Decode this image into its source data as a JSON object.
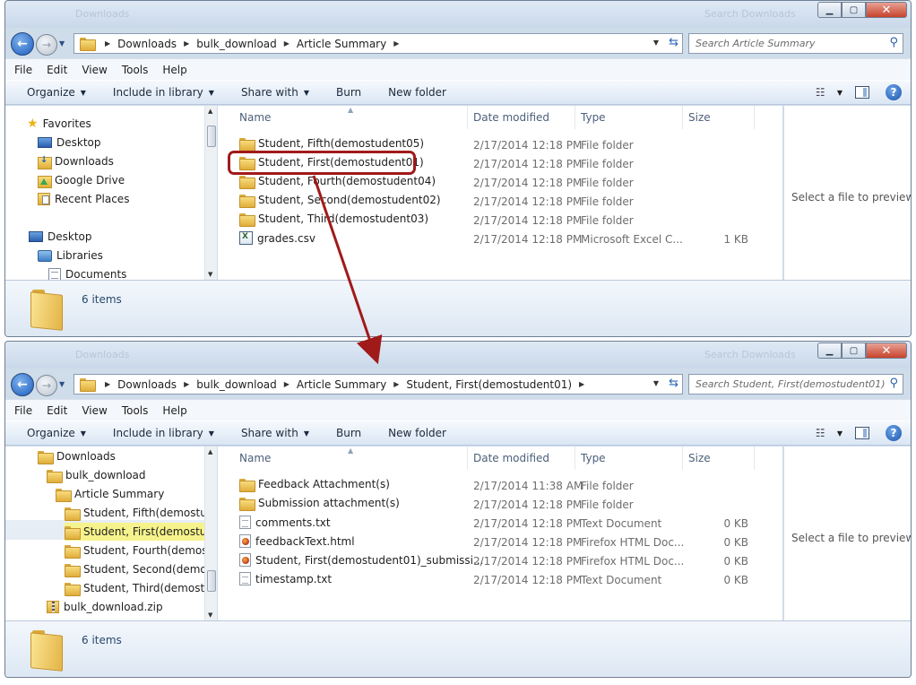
{
  "win1": {
    "title_blur": "Downloads",
    "title_blur_right": "Search Downloads",
    "breadcrumb": [
      "Downloads",
      "bulk_download",
      "Article Summary"
    ],
    "search_placeholder": "Search Article Summary",
    "menu": [
      "File",
      "Edit",
      "View",
      "Tools",
      "Help"
    ],
    "commands": [
      {
        "label": "Organize",
        "dropdown": true
      },
      {
        "label": "Include in library",
        "dropdown": true
      },
      {
        "label": "Share with",
        "dropdown": true
      },
      {
        "label": "Burn",
        "dropdown": false
      },
      {
        "label": "New folder",
        "dropdown": false
      }
    ],
    "nav": [
      {
        "label": "Favorites",
        "icon": "star-icon"
      },
      {
        "label": "Desktop",
        "icon": "desktop-icon"
      },
      {
        "label": "Downloads",
        "icon": "downloads-icon"
      },
      {
        "label": "Google Drive",
        "icon": "google-drive-icon"
      },
      {
        "label": "Recent Places",
        "icon": "recent-places-icon"
      },
      {
        "label": "Desktop",
        "icon": "desktop-icon"
      },
      {
        "label": "Libraries",
        "icon": "libraries-icon"
      },
      {
        "label": "Documents",
        "icon": "documents-icon"
      }
    ],
    "columns": [
      "Name",
      "Date modified",
      "Type",
      "Size"
    ],
    "files": [
      {
        "name": "Student, Fifth(demostudent05)",
        "date": "2/17/2014 12:18 PM",
        "type": "File folder",
        "size": "",
        "icon": "folder-icon"
      },
      {
        "name": "Student, First(demostudent01)",
        "date": "2/17/2014 12:18 PM",
        "type": "File folder",
        "size": "",
        "icon": "folder-icon"
      },
      {
        "name": "Student, Fourth(demostudent04)",
        "date": "2/17/2014 12:18 PM",
        "type": "File folder",
        "size": "",
        "icon": "folder-icon"
      },
      {
        "name": "Student, Second(demostudent02)",
        "date": "2/17/2014 12:18 PM",
        "type": "File folder",
        "size": "",
        "icon": "folder-icon"
      },
      {
        "name": "Student, Third(demostudent03)",
        "date": "2/17/2014 12:18 PM",
        "type": "File folder",
        "size": "",
        "icon": "folder-icon"
      },
      {
        "name": "grades.csv",
        "date": "2/17/2014 12:18 PM",
        "type": "Microsoft Excel C...",
        "size": "1 KB",
        "icon": "csv-file-icon"
      }
    ],
    "preview_text": "Select a file to preview.",
    "item_count": "6 items"
  },
  "win2": {
    "title_blur": "Downloads",
    "title_blur_right": "Search Downloads",
    "breadcrumb": [
      "Downloads",
      "bulk_download",
      "Article Summary",
      "Student, First(demostudent01)"
    ],
    "search_placeholder": "Search Student, First(demostudent01)",
    "menu": [
      "File",
      "Edit",
      "View",
      "Tools",
      "Help"
    ],
    "commands": [
      {
        "label": "Organize",
        "dropdown": true
      },
      {
        "label": "Include in library",
        "dropdown": true
      },
      {
        "label": "Share with",
        "dropdown": true
      },
      {
        "label": "Burn",
        "dropdown": false
      },
      {
        "label": "New folder",
        "dropdown": false
      }
    ],
    "nav": [
      {
        "label": "Downloads",
        "icon": "folder-icon"
      },
      {
        "label": "bulk_download",
        "icon": "folder-icon"
      },
      {
        "label": "Article Summary",
        "icon": "folder-icon"
      },
      {
        "label": "Student, Fifth(demostude",
        "icon": "folder-icon"
      },
      {
        "label": "Student, First(demostude",
        "icon": "folder-icon",
        "highlighted": true
      },
      {
        "label": "Student, Fourth(demostu",
        "icon": "folder-icon"
      },
      {
        "label": "Student, Second(demost",
        "icon": "folder-icon"
      },
      {
        "label": "Student, Third(demostud",
        "icon": "folder-icon"
      },
      {
        "label": "bulk_download.zip",
        "icon": "zip-icon"
      }
    ],
    "columns": [
      "Name",
      "Date modified",
      "Type",
      "Size"
    ],
    "files": [
      {
        "name": "Feedback Attachment(s)",
        "date": "2/17/2014 11:38 AM",
        "type": "File folder",
        "size": "",
        "icon": "folder-icon"
      },
      {
        "name": "Submission attachment(s)",
        "date": "2/17/2014 12:18 PM",
        "type": "File folder",
        "size": "",
        "icon": "folder-icon"
      },
      {
        "name": "comments.txt",
        "date": "2/17/2014 12:18 PM",
        "type": "Text Document",
        "size": "0 KB",
        "icon": "text-file-icon"
      },
      {
        "name": "feedbackText.html",
        "date": "2/17/2014 12:18 PM",
        "type": "Firefox HTML Doc...",
        "size": "0 KB",
        "icon": "firefox-html-icon"
      },
      {
        "name": "Student, First(demostudent01)_submissi...",
        "date": "2/17/2014 12:18 PM",
        "type": "Firefox HTML Doc...",
        "size": "0 KB",
        "icon": "firefox-html-icon"
      },
      {
        "name": "timestamp.txt",
        "date": "2/17/2014 12:18 PM",
        "type": "Text Document",
        "size": "0 KB",
        "icon": "text-file-icon"
      }
    ],
    "preview_text": "Select a file to preview.",
    "item_count": "6 items"
  },
  "colors": {
    "callout": "#a11a1a",
    "nav_highlight": "#f6f38c"
  }
}
